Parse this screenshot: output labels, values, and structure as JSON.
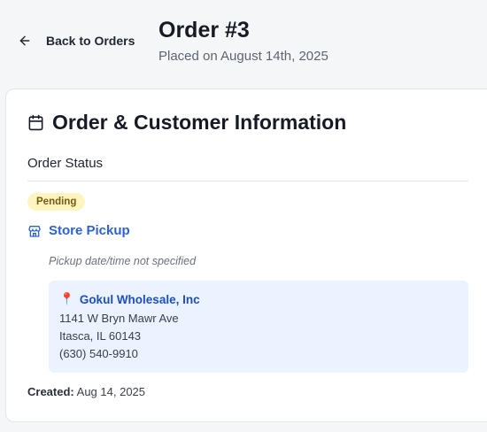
{
  "header": {
    "back_label": "Back to Orders",
    "title": "Order #3",
    "subtitle": "Placed on August 14th, 2025"
  },
  "card": {
    "title": "Order & Customer Information",
    "status_section_label": "Order Status",
    "status_badge": "Pending",
    "fulfillment": {
      "method": "Store Pickup",
      "note": "Pickup date/time not specified"
    },
    "store": {
      "pin_icon": "📍",
      "name": "Gokul Wholesale, Inc",
      "address_line1": "1141 W Bryn Mawr Ave",
      "address_line2": "Itasca, IL 60143",
      "phone": "(630) 540-9910"
    },
    "created_label": "Created:",
    "created_value": "Aug 14, 2025"
  },
  "colors": {
    "accent": "#2d63d0",
    "badge_bg": "#fdf4bf",
    "badge_text": "#7a5b0e",
    "store_bg": "#eaf3ff"
  }
}
